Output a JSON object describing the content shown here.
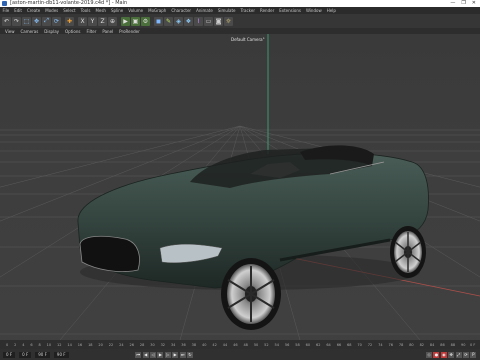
{
  "window": {
    "title": "[aston-martin-db11-volante-2019.c4d *] - Main",
    "controls": [
      "—",
      "❐",
      "✕"
    ]
  },
  "menubar": [
    "File",
    "Edit",
    "Create",
    "Modes",
    "Select",
    "Tools",
    "Mesh",
    "Spline",
    "Volume",
    "MoGraph",
    "Character",
    "Animate",
    "Simulate",
    "Tracker",
    "Render",
    "Extensions",
    "Window",
    "Help"
  ],
  "viewport_menu": [
    "View",
    "Cameras",
    "Display",
    "Options",
    "Filter",
    "Panel",
    "ProRender"
  ],
  "viewport": {
    "camera_label": "Default Camera°"
  },
  "timeline": {
    "ticks": [
      "0",
      "2",
      "4",
      "6",
      "8",
      "10",
      "12",
      "14",
      "16",
      "18",
      "20",
      "22",
      "24",
      "26",
      "28",
      "30",
      "32",
      "34",
      "36",
      "38",
      "40",
      "42",
      "44",
      "46",
      "48",
      "50",
      "52",
      "54",
      "56",
      "58",
      "60",
      "62",
      "64",
      "66",
      "68",
      "70",
      "72",
      "74",
      "76",
      "78",
      "80",
      "82",
      "84",
      "86",
      "88",
      "90"
    ],
    "end_label": "0 F"
  },
  "playbar": {
    "start": "0 F",
    "current": "0 F",
    "end": "90 F",
    "end2": "90 F"
  },
  "colors": {
    "car_body": "#34443f",
    "grid_x_axis": "#b0504a",
    "y_axis": "#3fb080"
  }
}
